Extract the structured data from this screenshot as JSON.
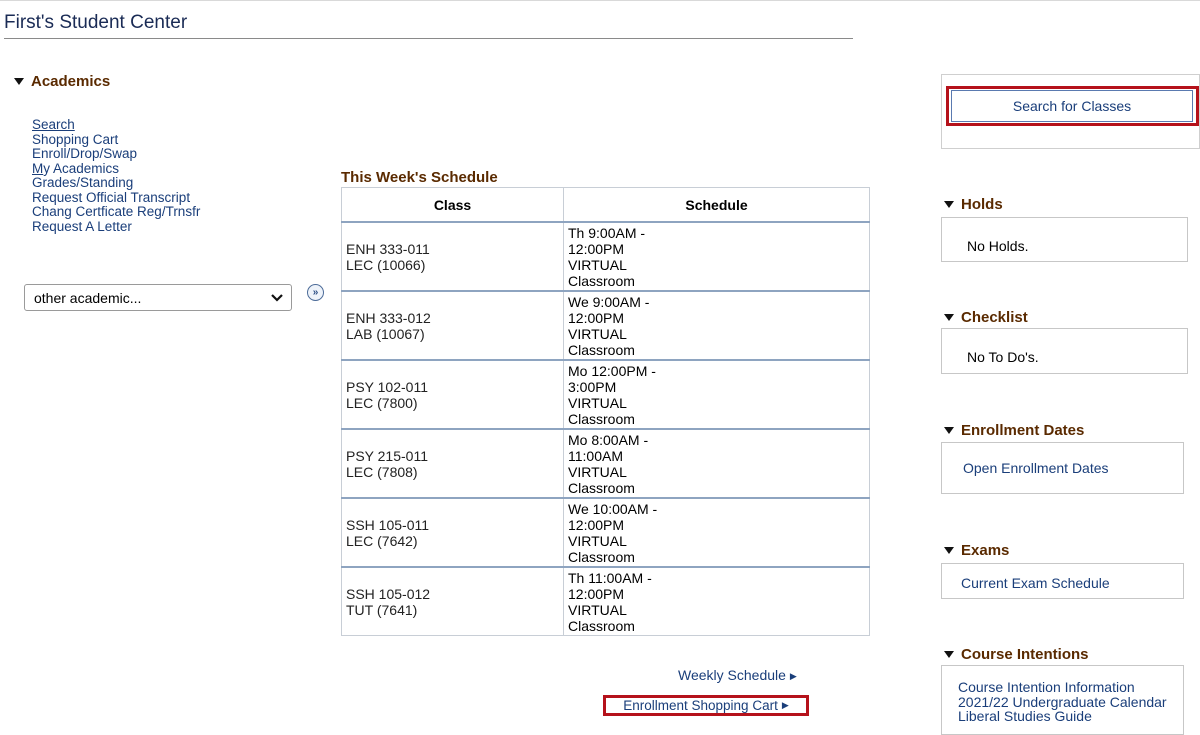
{
  "page": {
    "title": "First's Student Center"
  },
  "academics": {
    "heading": "Academics",
    "links": [
      "Search",
      "Shopping Cart",
      "Enroll/Drop/Swap",
      "My Academics",
      "Grades/Standing",
      "Request Official Transcript",
      "Chang Certficate Reg/Trnsfr",
      "Request A Letter"
    ],
    "other_select_value": "other academic..."
  },
  "schedule": {
    "title": "This Week's Schedule",
    "columns": [
      "Class",
      "Schedule"
    ],
    "rows": [
      {
        "class_line1": "ENH 333-011",
        "class_line2": "LEC (10066)",
        "sched_line1": "Th 9:00AM -",
        "sched_line2": "12:00PM",
        "sched_line3": "VIRTUAL",
        "sched_line4": "Classroom"
      },
      {
        "class_line1": "ENH 333-012",
        "class_line2": "LAB (10067)",
        "sched_line1": "We 9:00AM -",
        "sched_line2": "12:00PM",
        "sched_line3": "VIRTUAL",
        "sched_line4": "Classroom"
      },
      {
        "class_line1": "PSY 102-011",
        "class_line2": "LEC (7800)",
        "sched_line1": "Mo 12:00PM -",
        "sched_line2": "3:00PM",
        "sched_line3": "VIRTUAL",
        "sched_line4": "Classroom"
      },
      {
        "class_line1": "PSY 215-011",
        "class_line2": "LEC (7808)",
        "sched_line1": "Mo 8:00AM -",
        "sched_line2": "11:00AM",
        "sched_line3": "VIRTUAL",
        "sched_line4": "Classroom"
      },
      {
        "class_line1": "SSH 105-011",
        "class_line2": "LEC (7642)",
        "sched_line1": "We 10:00AM -",
        "sched_line2": "12:00PM",
        "sched_line3": "VIRTUAL",
        "sched_line4": "Classroom"
      },
      {
        "class_line1": "SSH 105-012",
        "class_line2": "TUT (7641)",
        "sched_line1": "Th 11:00AM -",
        "sched_line2": "12:00PM",
        "sched_line3": "VIRTUAL",
        "sched_line4": "Classroom"
      }
    ],
    "weekly_link": "Weekly Schedule",
    "cart_link": "Enrollment Shopping Cart"
  },
  "right": {
    "search_button": "Search for Classes",
    "holds": {
      "heading": "Holds",
      "text": "No Holds."
    },
    "checklist": {
      "heading": "Checklist",
      "text": "No To Do's."
    },
    "enrollment_dates": {
      "heading": "Enrollment Dates",
      "link": "Open Enrollment Dates"
    },
    "exams": {
      "heading": "Exams",
      "link": "Current Exam Schedule"
    },
    "course_intentions": {
      "heading": "Course Intentions",
      "links": [
        "Course Intention Information",
        "2021/22 Undergraduate Calendar",
        "Liberal Studies Guide"
      ]
    }
  },
  "colors": {
    "highlight": "#b5121b",
    "section_heading": "#5a2a00",
    "link": "#1a3e7a"
  }
}
